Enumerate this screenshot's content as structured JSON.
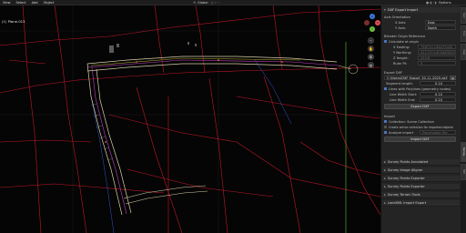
{
  "menu": {
    "items": [
      "View",
      "Select",
      "Add",
      "Object"
    ]
  },
  "header": {
    "viewport_mode": "Global",
    "options_label": "Options"
  },
  "viewport": {
    "label": "(1) Plane.013"
  },
  "gizmo": {
    "x_label": "X",
    "y_label": "Y",
    "z_label": "Z"
  },
  "sidebar": {
    "panel_title": "DXF Export Import",
    "axis_orientation": {
      "heading": "Axis Orientation",
      "x_axis_label": "X Axis:",
      "x_axis_value": "East",
      "y_axis_label": "Y Axis:",
      "y_axis_value": "North"
    },
    "blender_origin": {
      "heading": "Blender Origin Reference",
      "calc_label": "Calculate at origin",
      "x_label": "X Easting:",
      "x_value": "758719.236475430",
      "y_label": "Y Northing:",
      "y_value": "4111374.800483032",
      "z_label": "Z Height:",
      "z_value": "259.8",
      "ruler_label": "Ruler Pt:",
      "ruler_value": "0"
    },
    "export_dxf": {
      "heading": "Export DXF",
      "path": "C:\\Users\\DXF Export_20-11-2025.dxf",
      "segment_label": "Segment length:",
      "segment_value": "0.10",
      "lines_label": "Lines with Polylines (geometry nodes)",
      "lw_start_label": "Line Width Start:",
      "lw_start_value": "0.10",
      "lw_end_label": "Line Width End:",
      "lw_end_value": "0.10",
      "export_btn": "Export DXF"
    },
    "import": {
      "heading": "Import",
      "collection_label": "Collection: Scene Collection",
      "active_label": "Create active collection for imported objects",
      "analyze_label": "Analyze import",
      "analyze_value": "Placeholder file",
      "import_btn": "Import DXF"
    },
    "collapsed": [
      "Survey Points Annotated",
      "Survey Image Aligner",
      "Survey Points Exporter",
      "Survey Points Exporter",
      "Survey Terrain Tools",
      "LandXML Import Export"
    ]
  },
  "vtabs": [
    "Item",
    "Tool",
    "View",
    "Survey",
    "Edit"
  ],
  "colors": {
    "accent": "#4b79c4",
    "panel": "#242424",
    "road_edge": "#d8d0a8",
    "parcel": "#c0182a",
    "water": "#3a6cff"
  }
}
